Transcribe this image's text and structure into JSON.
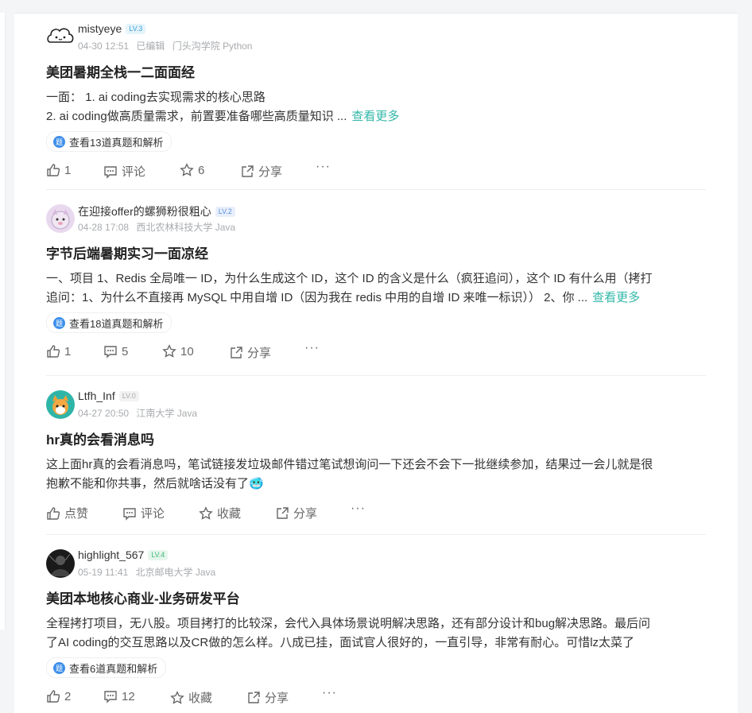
{
  "posts": [
    {
      "user": "mistyeye",
      "level": "LV.3",
      "date": "04-30 12:51",
      "edited": "已编辑",
      "meta": "门头沟学院 Python",
      "title": "美团暑期全栈一二面面经",
      "lines": [
        "一面： 1. ai coding去实现需求的核心思路",
        "2. ai coding做高质量需求，前置要准备哪些高质量知识 ..."
      ],
      "more": "查看更多",
      "tag": "查看13道真题和解析",
      "like": "1",
      "comment": "评论",
      "star": "6",
      "share": "分享",
      "dots": "···"
    },
    {
      "user": "在迎接offer的螺狮粉很粗心",
      "level": "LV.2",
      "date": "04-28 17:08",
      "meta": "西北农林科技大学 Java",
      "title": "字节后端暑期实习一面凉经",
      "lines": [
        "一、项目 1、Redis 全局唯一 ID，为什么生成这个 ID，这个 ID 的含义是什么（疯狂追问），这个 ID 有什么用（拷打",
        "追问：1、为什么不直接再 MySQL 中用自增 ID（因为我在 redis 中用的自增 ID 来唯一标识））  2、你 ..."
      ],
      "more": "查看更多",
      "tag": "查看18道真题和解析",
      "like": "1",
      "comment": "5",
      "star": "10",
      "share": "分享",
      "dots": "···"
    },
    {
      "user": "Ltfh_Inf",
      "level": "LV.0",
      "date": "04-27 20:50",
      "meta": "江南大学 Java",
      "title": "hr真的会看消息吗",
      "lines": [
        "这上面hr真的会看消息吗，笔试链接发垃圾邮件错过笔试想询问一下还会不会下一批继续参加，结果过一会儿就是很",
        "抱歉不能和你共事，然后就啥话没有了🥶"
      ],
      "like": "点赞",
      "comment": "评论",
      "star": "收藏",
      "share": "分享",
      "dots": "···"
    },
    {
      "user": "highlight_567",
      "level": "LV.4",
      "date": "05-19 11:41",
      "meta": "北京邮电大学 Java",
      "title": "美团本地核心商业-业务研发平台",
      "lines": [
        "全程拷打项目，无八股。项目拷打的比较深，会代入具体场景说明解决思路，还有部分设计和bug解决思路。最后问",
        "了AI coding的交互思路以及CR做的怎么样。八成已挂，面试官人很好的，一直引导，非常有耐心。可惜lz太菜了"
      ],
      "tag": "查看6道真题和解析",
      "like": "2",
      "comment": "12",
      "star": "收藏",
      "share": "分享",
      "dots": "···"
    }
  ],
  "colors": {
    "link": "#32b7a8",
    "lv3": "#3fa0d8",
    "lv2": "#5a8fe0",
    "lv0": "#aaaaaa",
    "lv4": "#3cb878"
  },
  "icons": [
    "thumb-up-icon",
    "comment-icon",
    "star-icon",
    "share-icon",
    "more-dots-icon",
    "question-bank-icon"
  ]
}
